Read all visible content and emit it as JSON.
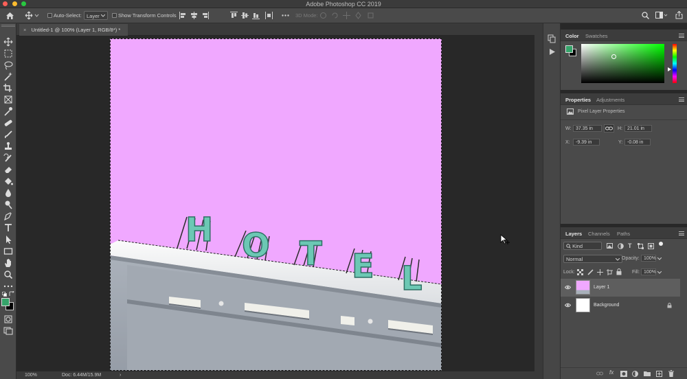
{
  "window": {
    "title": "Adobe Photoshop CC 2019"
  },
  "options_bar": {
    "auto_select_label": "Auto-Select:",
    "auto_select_target": "Layer",
    "show_transform_label": "Show Transform Controls",
    "mode_3d_label": "3D Mode:"
  },
  "document": {
    "tab_title": "Untitled-1 @ 100% (Layer 1, RGB/8*) *"
  },
  "canvas": {
    "sign_text": "HOTEL",
    "fill_color": "#f0a8ff",
    "sign_color": "#6cc8b4"
  },
  "status": {
    "zoom": "100%",
    "doc_info": "Doc: 6.44M/15.9M"
  },
  "tools": {
    "foreground_color": "#35a46a",
    "background_color": "#000000"
  },
  "color_panel": {
    "tabs": [
      "Color",
      "Swatches"
    ],
    "foreground_color": "#35a46a",
    "picker_hue": "#00ff00"
  },
  "properties_panel": {
    "tabs": [
      "Properties",
      "Adjustments"
    ],
    "section_title": "Pixel Layer Properties",
    "w_label": "W:",
    "w_value": "37.35 in",
    "h_label": "H:",
    "h_value": "21.01 in",
    "x_label": "X:",
    "x_value": "-9.39 in",
    "y_label": "Y:",
    "y_value": "-0.08 in"
  },
  "layers_panel": {
    "tabs": [
      "Layers",
      "Channels",
      "Paths"
    ],
    "filter_kind": "Kind",
    "blend_mode": "Normal",
    "opacity_label": "Opacity:",
    "opacity_value": "100%",
    "lock_label": "Lock:",
    "fill_label": "Fill:",
    "fill_value": "100%",
    "layers": [
      {
        "name": "Layer 1",
        "selected": true
      },
      {
        "name": "Background",
        "selected": false
      }
    ]
  }
}
